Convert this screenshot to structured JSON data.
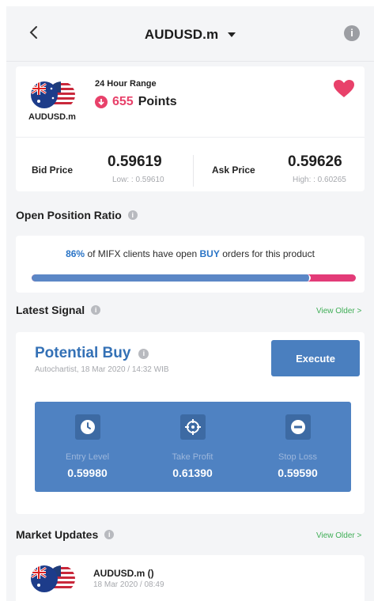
{
  "header": {
    "title": "AUDUSD.m",
    "info_glyph": "i"
  },
  "summary": {
    "flag_label": "AUDUSD.m",
    "range_title": "24 Hour Range",
    "points_value": "655",
    "points_unit": "Points",
    "bid_label": "Bid Price",
    "bid_value": "0.59619",
    "low_text": "Low: : 0.59610",
    "ask_label": "Ask Price",
    "ask_value": "0.59626",
    "high_text": "High: : 0.60265"
  },
  "open_position": {
    "title": "Open Position Ratio",
    "percent": "86%",
    "text_before": " of MIFX clients have open ",
    "buy_word": "BUY",
    "text_after": " orders for this product",
    "buy_fraction": 0.86
  },
  "signal": {
    "section_title": "Latest Signal",
    "view_older": "View Older >",
    "title": "Potential Buy",
    "source": "Autochartist, 18 Mar 2020 / 14:32 WIB",
    "execute_label": "Execute",
    "levels": [
      {
        "name": "Entry Level",
        "value": "0.59980",
        "icon": "clock-icon"
      },
      {
        "name": "Take Profit",
        "value": "0.61390",
        "icon": "crosshair-icon"
      },
      {
        "name": "Stop Loss",
        "value": "0.59590",
        "icon": "minus-circle-icon"
      }
    ]
  },
  "market_updates": {
    "section_title": "Market Updates",
    "view_older": "View Older >",
    "item_title": "AUDUSD.m ()",
    "item_time": "18 Mar 2020 / 08:49"
  },
  "colors": {
    "accent_blue": "#3471b6",
    "pink": "#e8416a",
    "green": "#3fae56",
    "level_panel": "#4f82c2"
  }
}
